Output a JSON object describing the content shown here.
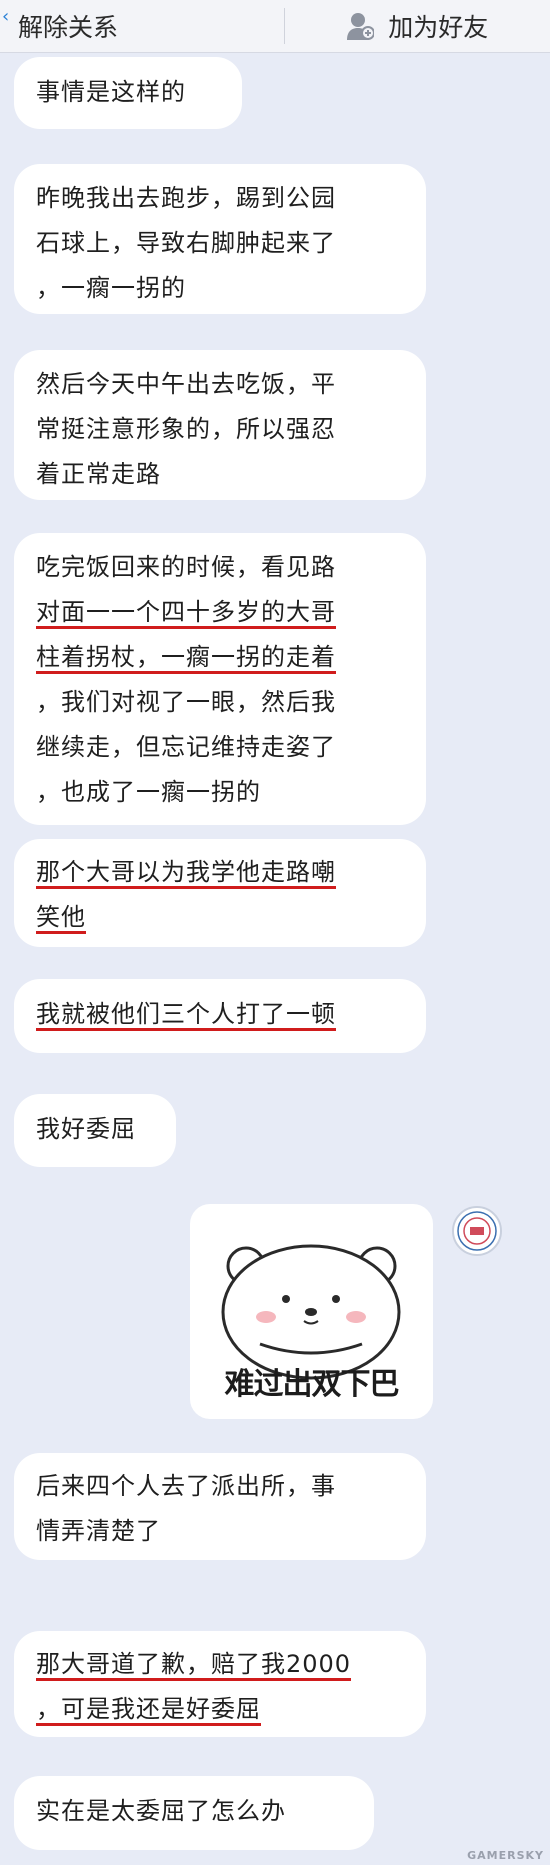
{
  "header": {
    "left_label": "解除关系",
    "right_label": "加为好友"
  },
  "messages": [
    {
      "lines": [
        "事情是这样的"
      ]
    },
    {
      "lines": [
        "昨晚我出去跑步，踢到公园",
        "石球上，导致右脚肿起来了",
        "，一瘸一拐的"
      ]
    },
    {
      "lines": [
        "然后今天中午出去吃饭，平",
        "常挺注意形象的，所以强忍",
        "着正常走路"
      ]
    },
    {
      "lines": [
        "吃完饭回来的时候，看见路",
        "对面一一个四十多岁的大哥",
        "柱着拐杖，一瘸一拐的走着",
        "，我们对视了一眼，然后我",
        "继续走，但忘记维持走姿了",
        "，也成了一瘸一拐的"
      ]
    },
    {
      "lines": [
        "那个大哥以为我学他走路嘲",
        "笑他"
      ]
    },
    {
      "lines": [
        "我就被他们三个人打了一顿"
      ]
    },
    {
      "lines": [
        "我好委屈"
      ]
    },
    {
      "lines": [
        "后来四个人去了派出所，事",
        "情弄清楚了"
      ]
    },
    {
      "lines": [
        "那大哥道了歉，赔了我2000",
        "，可是我还是好委屈"
      ]
    },
    {
      "lines": [
        "实在是太委屈了怎么办"
      ]
    }
  ],
  "sticker": {
    "caption": "难过出双下巴"
  },
  "watermark": "GAMERSKY"
}
